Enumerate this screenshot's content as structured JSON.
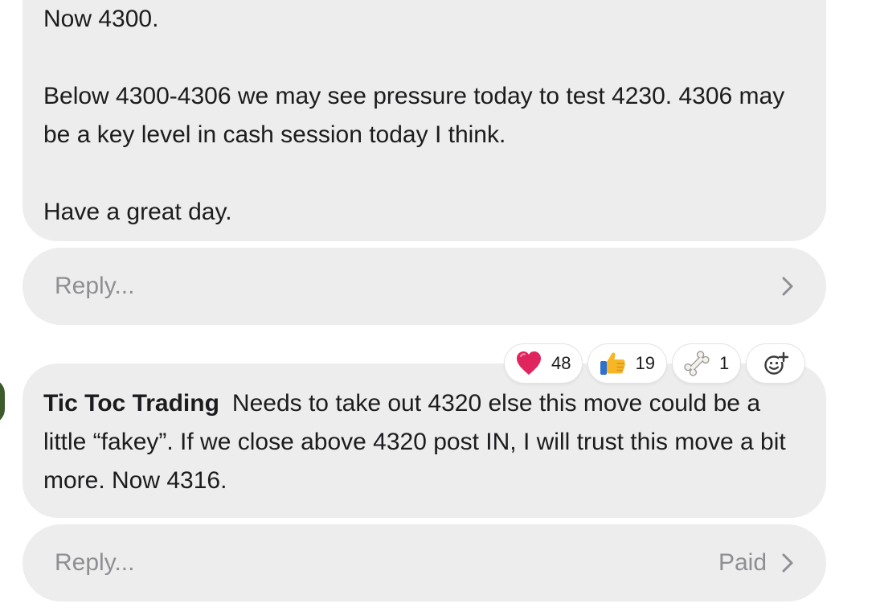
{
  "messages": {
    "first": {
      "paragraphs": [
        "Now 4300.",
        "Below 4300-4306 we may see pressure today to test 4230. 4306 may be a key level in cash session today I think.",
        "Have a great day."
      ],
      "reply_placeholder": "Reply..."
    },
    "second": {
      "author": "Tic Toc Trading",
      "text": "Needs to take out 4320 else this move could be a little “fakey”. If we close above 4320 post IN, I will trust this move a bit more. Now 4316.",
      "reactions": [
        {
          "icon": "heart-icon",
          "count": "48"
        },
        {
          "icon": "thumbs-up-icon",
          "count": "19"
        },
        {
          "icon": "bone-icon",
          "count": "1"
        }
      ],
      "add_reaction_icon": "add-reaction-icon",
      "reply_placeholder": "Reply...",
      "paid_label": "Paid"
    }
  },
  "colors": {
    "bubble": "#ededed",
    "muted_text": "#8e8e93",
    "heart": "#e0245e",
    "thumb": "#f6b626"
  }
}
